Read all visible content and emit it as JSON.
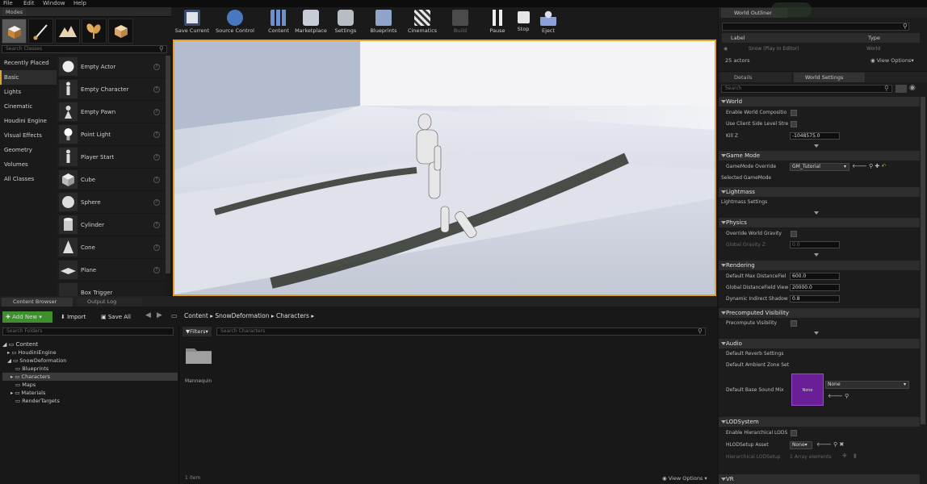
{
  "menubar": {
    "items": [
      "File",
      "Edit",
      "Window",
      "Help"
    ]
  },
  "modes": {
    "tab_title": "Modes",
    "search_placeholder": "Search Classes",
    "categories": [
      "Recently Placed",
      "Basic",
      "Lights",
      "Cinematic",
      "Houdini Engine",
      "Visual Effects",
      "Geometry",
      "Volumes",
      "All Classes"
    ],
    "selected_category": "Basic",
    "actors": [
      "Empty Actor",
      "Empty Character",
      "Empty Pawn",
      "Point Light",
      "Player Start",
      "Cube",
      "Sphere",
      "Cylinder",
      "Cone",
      "Plane",
      "Box Trigger"
    ],
    "help_glyph": "?"
  },
  "toolbar": {
    "buttons": [
      "Save Current",
      "Source Control",
      "Content",
      "Marketplace",
      "Settings",
      "Blueprints",
      "Cinematics",
      "Build",
      "Pause",
      "Stop",
      "Eject"
    ]
  },
  "content_browser": {
    "tabs": [
      "Content Browser",
      "Output Log"
    ],
    "add_new": "Add New",
    "import": "Import",
    "save_all": "Save All",
    "breadcrumb": [
      "Content",
      "SnowDeformation",
      "Characters"
    ],
    "search_folders_placeholder": "Search Folders",
    "filters": "Filters",
    "search_characters_placeholder": "Search Characters",
    "tree": [
      "Content",
      "HoudiniEngine",
      "SnowDeformation",
      "Blueprints",
      "Characters",
      "Maps",
      "Materials",
      "RenderTargets"
    ],
    "selected_folder": "Characters",
    "asset_name": "Mannequin",
    "item_count": "1 item",
    "view_options": "View Options"
  },
  "outliner": {
    "tab_title": "World Outliner",
    "col_label": "Label",
    "col_type": "Type",
    "row_label": "Snow (Play In Editor)",
    "row_type": "World",
    "actor_count": "25 actors",
    "view_options": "View Options"
  },
  "details": {
    "tabs": [
      "Details",
      "World Settings"
    ],
    "search_placeholder": "Search",
    "sections": {
      "world": "World",
      "game_mode": "Game Mode",
      "lightmass": "Lightmass",
      "physics": "Physics",
      "rendering": "Rendering",
      "precomputed": "Precomputed Visibility",
      "audio": "Audio",
      "lod": "LODSystem",
      "vr": "VR"
    },
    "props": {
      "enable_world_composition": "Enable World Compositio",
      "client_side_level": "Use Client Side Level Stre",
      "kill_z": "Kill Z",
      "kill_z_value": "-1048575.0",
      "gamemode_override": "GameMode Override",
      "gamemode_value": "GM_Tutorial",
      "selected_gamemode": "Selected GameMode",
      "lightmass_settings": "Lightmass Settings",
      "override_gravity": "Override World Gravity",
      "global_gravity": "Global Gravity Z",
      "global_gravity_value": "0.0",
      "max_distance_field": "Default Max DistanceFiel",
      "max_distance_field_value": "600.0",
      "global_distance_view": "Global DistanceField View",
      "global_distance_view_value": "20000.0",
      "dynamic_indirect": "Dynamic Indirect Shadow",
      "dynamic_indirect_value": "0.8",
      "precompute_visibility": "Precompute Visibility",
      "reverb_settings": "Default Reverb Settings",
      "ambient_zone": "Default Ambient Zone Set",
      "base_sound_mix": "Default Base Sound Mix",
      "sound_mix_thumb": "None",
      "sound_mix_value": "None",
      "enable_hlod": "Enable Hierarchical LODS",
      "hlod_asset": "HLODSetup Asset",
      "hlod_value": "None",
      "hlod_setup": "Hierarchical LODSetup",
      "hlod_array": "1 Array elements"
    }
  },
  "colors": {
    "accent": "#e3a32a",
    "add_new": "#3f8f2f",
    "sound_mix": "#6a1f96"
  }
}
